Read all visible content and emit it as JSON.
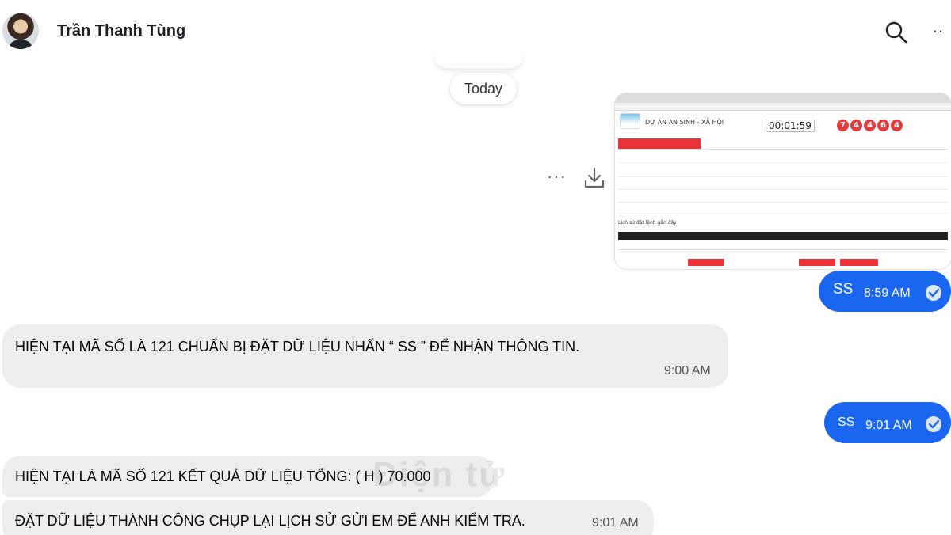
{
  "header": {
    "contact_name": "Trần Thanh Tùng",
    "search_icon": "search-icon",
    "more_icon": "more-horizontal-icon",
    "more_label": "··"
  },
  "date_divider": "Today",
  "attachment": {
    "more_label": "···",
    "download_icon": "download-icon",
    "screenshot": {
      "site_title": "DỰ ÁN AN SINH - XÃ HỘI",
      "timer": "00:01:59",
      "balls": [
        "7",
        "4",
        "4",
        "6",
        "4"
      ],
      "history_title": "Lịch sử đặt lệnh gần đây"
    }
  },
  "messages": [
    {
      "direction": "out",
      "text": "SS",
      "time": "8:59 AM",
      "status_icon": "read-check-icon"
    },
    {
      "direction": "in",
      "text": "HIỆN TẠI MÃ SỐ LÀ  121 CHUẨN BỊ ĐẶT DỮ LIỆU NHẤN  “ SS  ”  ĐỂ NHẬN THÔNG TIN.",
      "time": "9:00 AM"
    },
    {
      "direction": "out",
      "text": "SS",
      "time": "9:01 AM",
      "status_icon": "read-check-icon"
    },
    {
      "direction": "in",
      "text": "HIỆN TẠI LÀ MÃ SỐ 121 KẾT QUẢ DỮ LIỆU TỔNG: ( H )  70.000"
    },
    {
      "direction": "in",
      "text": "ĐẶT DỮ LIỆU THÀNH CÔNG CHỤP LẠI LỊCH SỬ GỬI EM ĐỂ ANH KIỂM TRA.",
      "time": "9:01 AM"
    }
  ],
  "colors": {
    "outgoing_bubble": "#1a66f0",
    "incoming_bubble": "#ededed",
    "accent_red": "#e8333b"
  }
}
